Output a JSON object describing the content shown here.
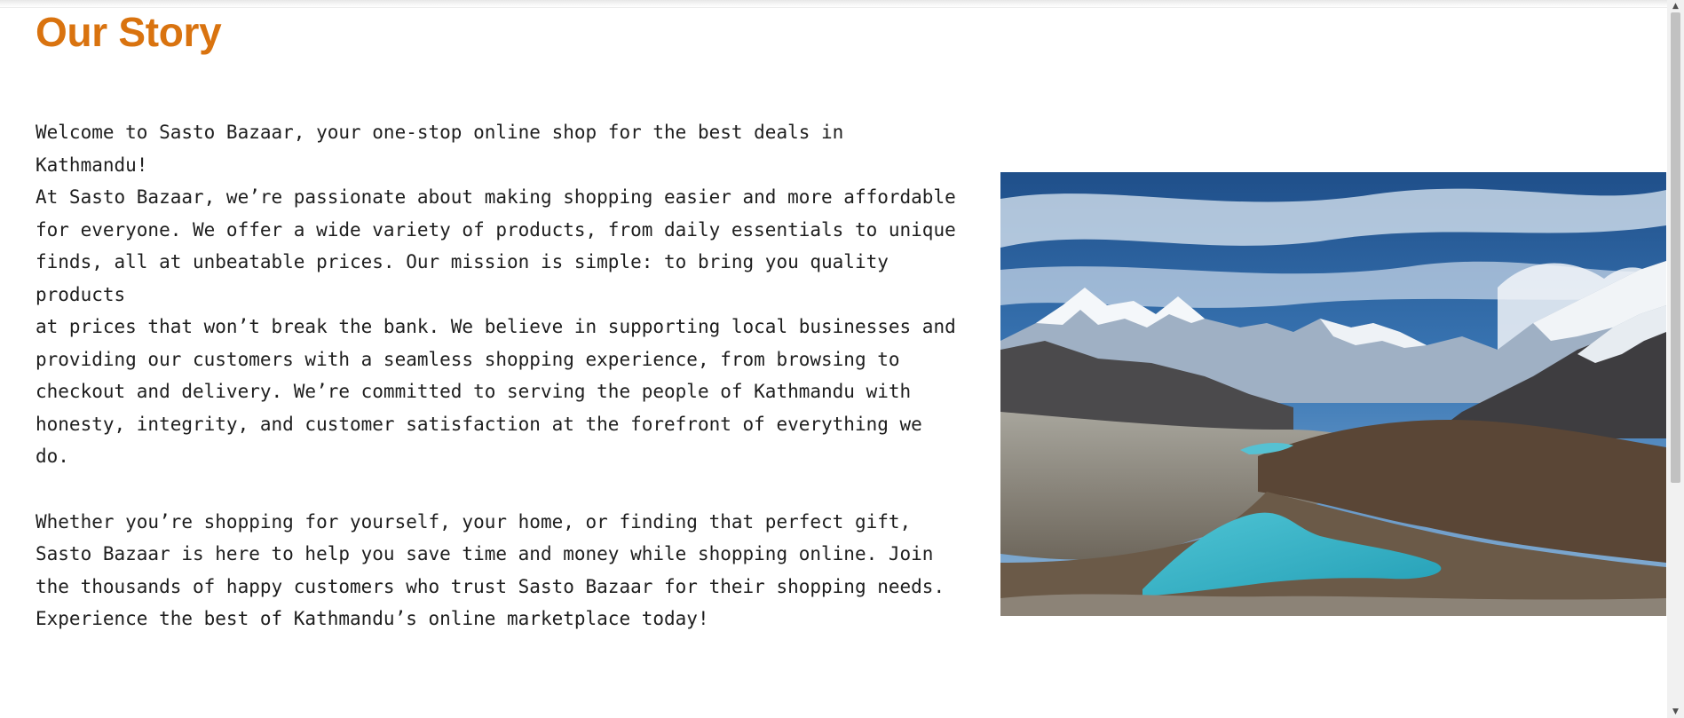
{
  "page": {
    "title": "Our Story",
    "paragraphs": [
      [
        "Welcome to Sasto Bazaar, your one-stop online shop for the best deals in",
        "Kathmandu!",
        "At Sasto Bazaar, we’re passionate about making shopping easier and more affordable",
        "for everyone. We offer a wide variety of products, from daily essentials to unique",
        "finds, all at unbeatable prices. Our mission is simple: to bring you quality",
        "products",
        "at prices that won’t break the bank. We believe in supporting local businesses and",
        "providing our customers with a seamless shopping experience, from browsing to",
        "checkout and delivery. We’re committed to serving the people of Kathmandu with",
        "honesty, integrity, and customer satisfaction at the forefront of everything we",
        "do."
      ],
      [
        "Whether you’re shopping for yourself, your home, or finding that perfect gift,",
        "Sasto Bazaar is here to help you save time and money while shopping online. Join",
        "the thousands of happy customers who trust Sasto Bazaar for their shopping needs.",
        "Experience the best of Kathmandu’s online marketplace today!"
      ]
    ]
  },
  "colors": {
    "title": "#d9730f",
    "text": "#1e1e1e",
    "background": "#ffffff",
    "lake": "#3fb6c9",
    "sky": "#3b78b6"
  },
  "image": {
    "subject": "mountain lake landscape photo"
  },
  "scrollbar": {
    "up_icon": "scroll-up-arrow-icon",
    "down_icon": "scroll-down-arrow-icon",
    "position_fraction": 0.0
  }
}
